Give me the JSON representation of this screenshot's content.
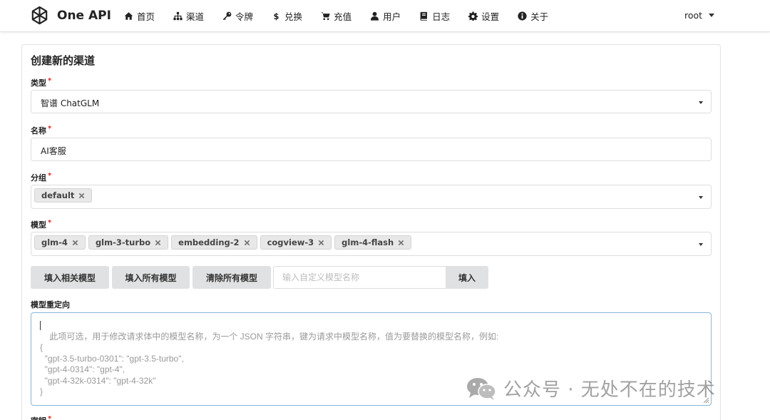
{
  "app": {
    "name": "One API"
  },
  "nav": {
    "items": [
      {
        "label": "首页",
        "icon": "home-icon"
      },
      {
        "label": "渠道",
        "icon": "sitemap-icon"
      },
      {
        "label": "令牌",
        "icon": "key-icon"
      },
      {
        "label": "兑换",
        "icon": "dollar-icon"
      },
      {
        "label": "充值",
        "icon": "cart-icon"
      },
      {
        "label": "用户",
        "icon": "user-icon"
      },
      {
        "label": "日志",
        "icon": "book-icon"
      },
      {
        "label": "设置",
        "icon": "gear-icon"
      },
      {
        "label": "关于",
        "icon": "info-icon"
      }
    ],
    "user": "root"
  },
  "form": {
    "title": "创建新的渠道",
    "type": {
      "label": "类型",
      "value": "智谱 ChatGLM"
    },
    "name": {
      "label": "名称",
      "value": "AI客服"
    },
    "group": {
      "label": "分组",
      "chips": [
        "default"
      ]
    },
    "models": {
      "label": "模型",
      "chips": [
        "glm-4",
        "glm-3-turbo",
        "embedding-2",
        "cogview-3",
        "glm-4-flash"
      ]
    },
    "buttons": {
      "fill_related": "填入相关模型",
      "fill_all": "填入所有模型",
      "clear_all": "清除所有模型",
      "custom_placeholder": "输入自定义模型名称",
      "fill": "填入"
    },
    "mapping": {
      "label": "模型重定向",
      "placeholder": "此项可选，用于修改请求体中的模型名称，为一个 JSON 字符串，键为请求中模型名称，值为要替换的模型名称，例如:\n{\n  \"gpt-3.5-turbo-0301\": \"gpt-3.5-turbo\",\n  \"gpt-4-0314\": \"gpt-4\",\n  \"gpt-4-32k-0314\": \"gpt-4-32k\"\n}"
    },
    "key": {
      "label": "密钥"
    }
  },
  "watermark": {
    "text": "公众号 · 无处不在的技术"
  },
  "colors": {
    "required": "#db2828",
    "button_bg": "#e0e1e2",
    "focus_border": "#85b7d9"
  }
}
